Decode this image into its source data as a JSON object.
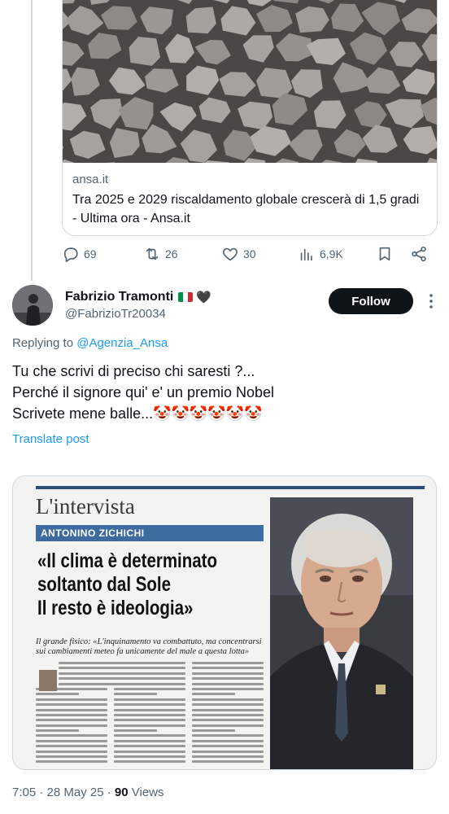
{
  "link_card": {
    "domain": "ansa.it",
    "title": "Tra 2025 e 2029 riscaldamento globale crescerà di 1,5 gradi - Ultima ora - Ansa.it"
  },
  "actions": {
    "replies": "69",
    "reposts": "26",
    "likes": "30",
    "views": "6,9K"
  },
  "post": {
    "author_name": "Fabrizio Tramonti",
    "heart_emoji": "🖤",
    "author_handle": "@FabrizioTr20034",
    "follow_label": "Follow",
    "replying_prefix": "Replying to",
    "replying_to": "@Agenzia_Ansa",
    "lines": [
      "Tu che scrivi di preciso chi saresti ?...",
      "Perché il signore qui' e' un premio Nobel",
      "Scrivete mene balle...🤡🤡🤡🤡🤡🤡"
    ],
    "translate_label": "Translate post",
    "timestamp": "7:05 · 28 May 25 ·",
    "views_count": "90",
    "views_label": "Views"
  },
  "newspaper": {
    "kicker": "L'intervista",
    "band": "ANTONINO ZICHICHI",
    "headline_lines": [
      "«Il clima è determinato",
      "soltanto dal Sole",
      "Il resto è ideologia»"
    ],
    "subhead": "Il grande fisico: «L'inquinamento va combattuto, ma concentrarsi sui cambiamenti meteo fa unicamente del male a questa lotta»"
  },
  "colors": {
    "accent": "#1d9bf0",
    "text": "#0f1419",
    "muted": "#536471",
    "border": "#cfd9de",
    "flag_green": "#009246",
    "flag_white": "#ffffff",
    "flag_red": "#ce2b37"
  },
  "icons": [
    "reply-icon",
    "repost-icon",
    "like-icon",
    "views-icon",
    "bookmark-icon",
    "share-icon",
    "more-icon"
  ]
}
